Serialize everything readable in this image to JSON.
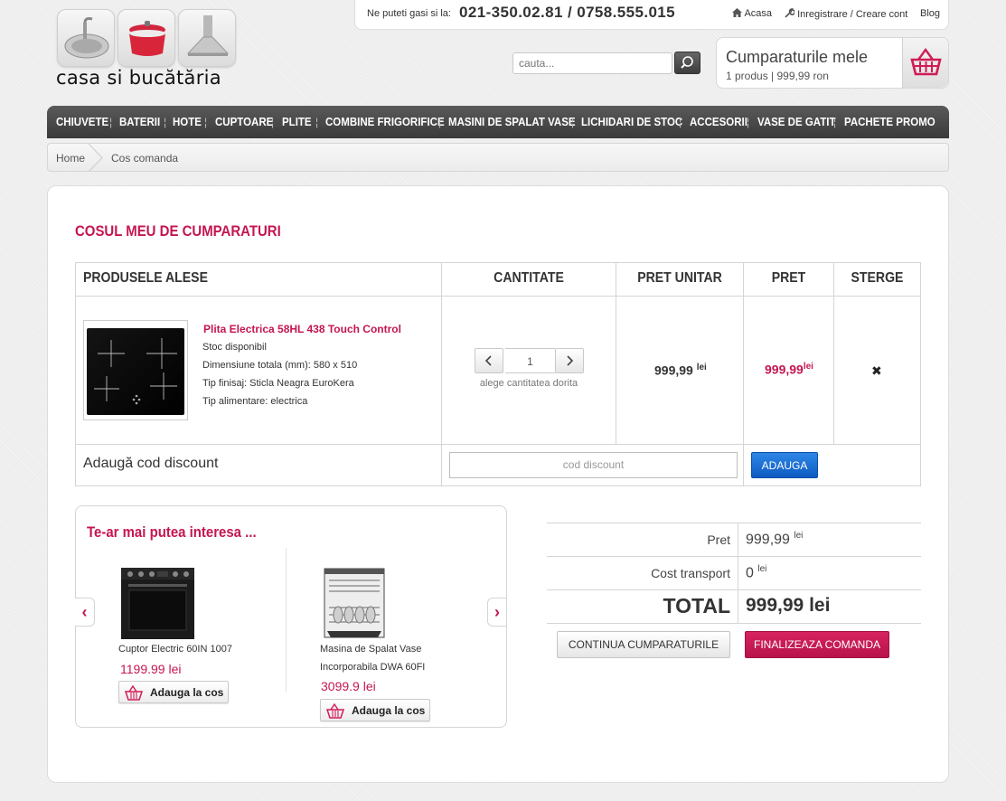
{
  "brand": {
    "name": "casa si bucătăria",
    "accent_color": "#c4164f",
    "nav_color": "#3a3a3a"
  },
  "header": {
    "phone_label": "Ne puteti gasi si la:",
    "phone": "021-350.02.81 / 0758.555.015",
    "links": [
      {
        "label": "Acasa",
        "icon": "home-icon"
      },
      {
        "label": "Inregistrare / Creare cont",
        "icon": "wrench-icon"
      },
      {
        "label": "Blog",
        "icon": ""
      }
    ],
    "search_placeholder": "cauta...",
    "cart": {
      "title": "Cumparaturile mele",
      "summary": "1 produs | 999,99 ron"
    }
  },
  "nav": {
    "items": [
      "CHIUVETE",
      "BATERII",
      "HOTE",
      "CUPTOARE",
      "PLITE",
      "COMBINE FRIGORIFICE",
      "MASINI DE SPALAT VASE",
      "LICHIDARI DE STOC",
      "ACCESORII",
      "VASE DE GATIT",
      "PACHETE PROMO"
    ]
  },
  "breadcrumb": [
    "Home",
    "Cos comanda"
  ],
  "cart_page": {
    "title": "COSUL MEU DE CUMPARATURI",
    "columns": [
      "PRODUSELE ALESE",
      "CANTITATE",
      "PRET UNITAR",
      "PRET",
      "STERGE"
    ],
    "item": {
      "name": "Plita Electrica 58HL 438 Touch Control",
      "specs": [
        "Stoc disponibil",
        "Dimensiune totala (mm): 580 x 510",
        "Tip finisaj: Sticla Neagra EuroKera",
        "Tip alimentare: electrica"
      ],
      "quantity": "1",
      "quantity_hint": "alege cantitatea dorita",
      "unit_price": "999,99",
      "price": "999,99",
      "currency": "lei",
      "delete_symbol": "✖"
    },
    "discount": {
      "label": "Adaugă cod discount",
      "placeholder": "cod discount",
      "button": "ADAUGA"
    }
  },
  "suggestions": {
    "title": "Te-ar mai putea interesa ...",
    "prev": "‹",
    "next": "›",
    "products": [
      {
        "name_lines": [
          "Cuptor Electric 60IN 1007"
        ],
        "price": "1199.99 lei",
        "button": "Adauga la cos"
      },
      {
        "name_lines": [
          "Masina de Spalat Vase",
          "Incorporabila DWA 60FI"
        ],
        "price": "3099.9 lei",
        "button": "Adauga la cos"
      }
    ]
  },
  "totals": {
    "price_label": "Pret",
    "price_value": "999,99",
    "shipping_label": "Cost transport",
    "shipping_value": "0",
    "currency": "lei",
    "total_label": "TOTAL",
    "total_value": "999,99 lei",
    "continue_button": "CONTINUA CUMPARATURILE",
    "finish_button": "FINALIZEAZA COMANDA"
  }
}
